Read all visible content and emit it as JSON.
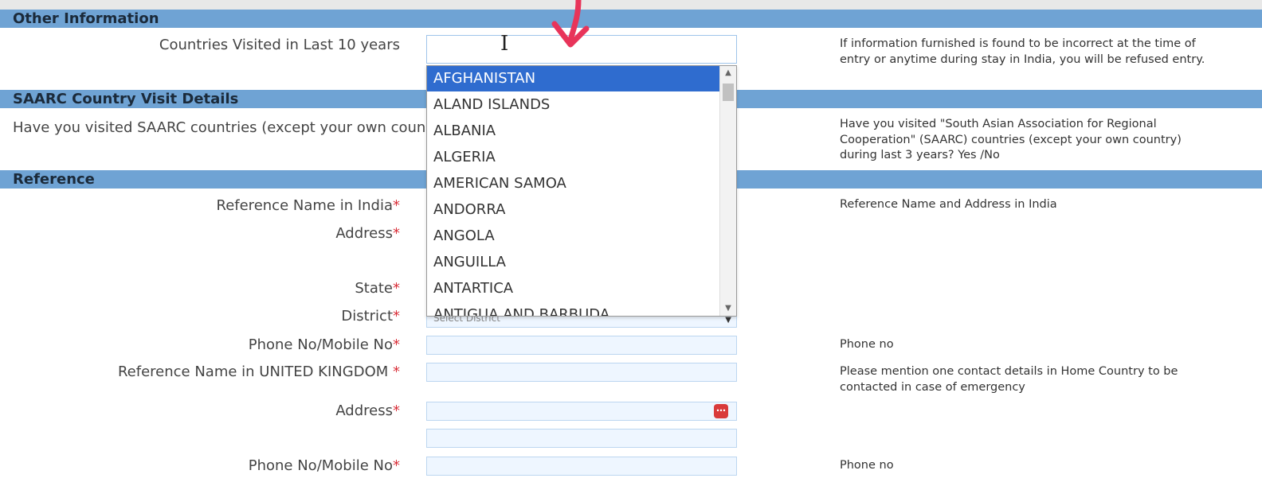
{
  "sections": {
    "other_info": "Other Information",
    "saarc": "SAARC Country Visit Details",
    "reference": "Reference"
  },
  "fields": {
    "countries_visited_label": "Countries Visited in Last 10 years",
    "saarc_question_label": "Have you visited SAARC countries (except your own coun",
    "ref_name_india_label": "Reference Name in India",
    "address_label": "Address",
    "state_label": "State",
    "district_label": "District",
    "district_placeholder": "Select District",
    "phone_label": "Phone No/Mobile No",
    "ref_name_uk_label": "Reference Name in UNITED KINGDOM ",
    "address2_label": "Address",
    "phone2_label": "Phone No/Mobile No",
    "required_mark": "*"
  },
  "help": {
    "countries_visited": "If information furnished is found to be incorrect at the time of entry or anytime during stay in India, you will be refused entry.",
    "saarc": "Have you visited \"South Asian Association for Regional Cooperation\" (SAARC) countries (except your own country) during last 3 years? Yes /No",
    "ref_india": "Reference Name and Address in India",
    "phone": "Phone no",
    "ref_uk": "Please mention one contact details in Home Country to be contacted in case of emergency",
    "phone2": "Phone no"
  },
  "dropdown": {
    "items": [
      "AFGHANISTAN",
      "ALAND ISLANDS",
      "ALBANIA",
      "ALGERIA",
      "AMERICAN SAMOA",
      "ANDORRA",
      "ANGOLA",
      "ANGUILLA",
      "ANTARTICA",
      "ANTIGUA AND BARBUDA"
    ],
    "selected_index": 0
  },
  "icons": {
    "calendar": "calendar-icon",
    "cursor": "text-cursor-icon",
    "arrow": "annotation-arrow-icon"
  },
  "colors": {
    "section_bg": "#6fa3d4",
    "required": "#d9303a",
    "selected_bg": "#2f6ccf",
    "annotation_arrow": "#e8345a"
  }
}
